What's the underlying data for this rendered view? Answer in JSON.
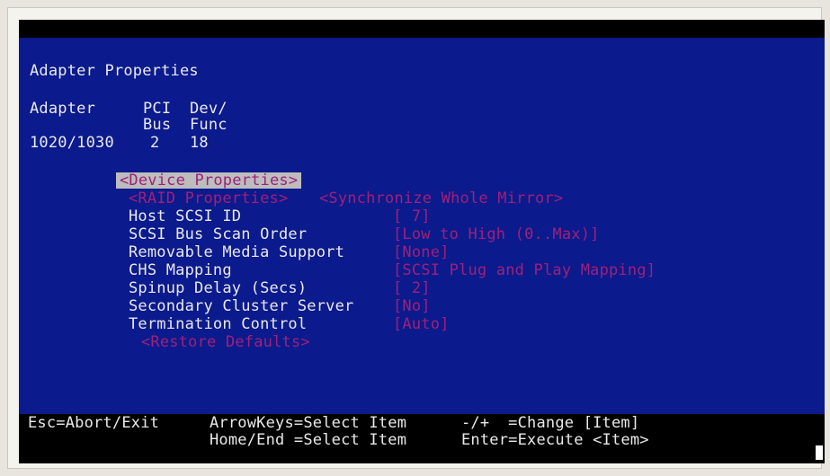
{
  "header": {
    "title": "Adapter Properties"
  },
  "adapter_table": {
    "col1_header": "Adapter",
    "col2_header_line1": "PCI",
    "col2_header_line2": "Bus",
    "col3_header_line1": "Dev/",
    "col3_header_line2": "Func",
    "adapter": "1020/1030",
    "bus": "2",
    "func": "18"
  },
  "menu": {
    "device_properties": "<Device Properties>",
    "raid_properties": "<RAID Properties>",
    "synchronize_whole_mirror": "<Synchronize Whole Mirror>",
    "restore_defaults": "<Restore Defaults>"
  },
  "settings": [
    {
      "label": "Host SCSI ID",
      "value": "[ 7]"
    },
    {
      "label": "SCSI Bus Scan Order",
      "value": "[Low to High (0..Max)]"
    },
    {
      "label": "Removable Media Support",
      "value": "[None]"
    },
    {
      "label": "CHS Mapping",
      "value": "[SCSI Plug and Play Mapping]"
    },
    {
      "label": "Spinup Delay (Secs)",
      "value": "[ 2]"
    },
    {
      "label": "Secondary Cluster Server",
      "value": "[No]"
    },
    {
      "label": "Termination Control",
      "value": "[Auto]"
    }
  ],
  "status_bar": {
    "esc": "Esc=Abort/Exit",
    "arrow": "ArrowKeys=Select Item",
    "homeend": "Home/End =Select Item",
    "change": "-/+  =Change [Item]",
    "enter": "Enter=Execute <Item>"
  },
  "colors": {
    "background_blue": "#0b1a8c",
    "text": "#e9e9e9",
    "dim_magenta": "#a0207a",
    "highlight": "#bdbdbd"
  }
}
